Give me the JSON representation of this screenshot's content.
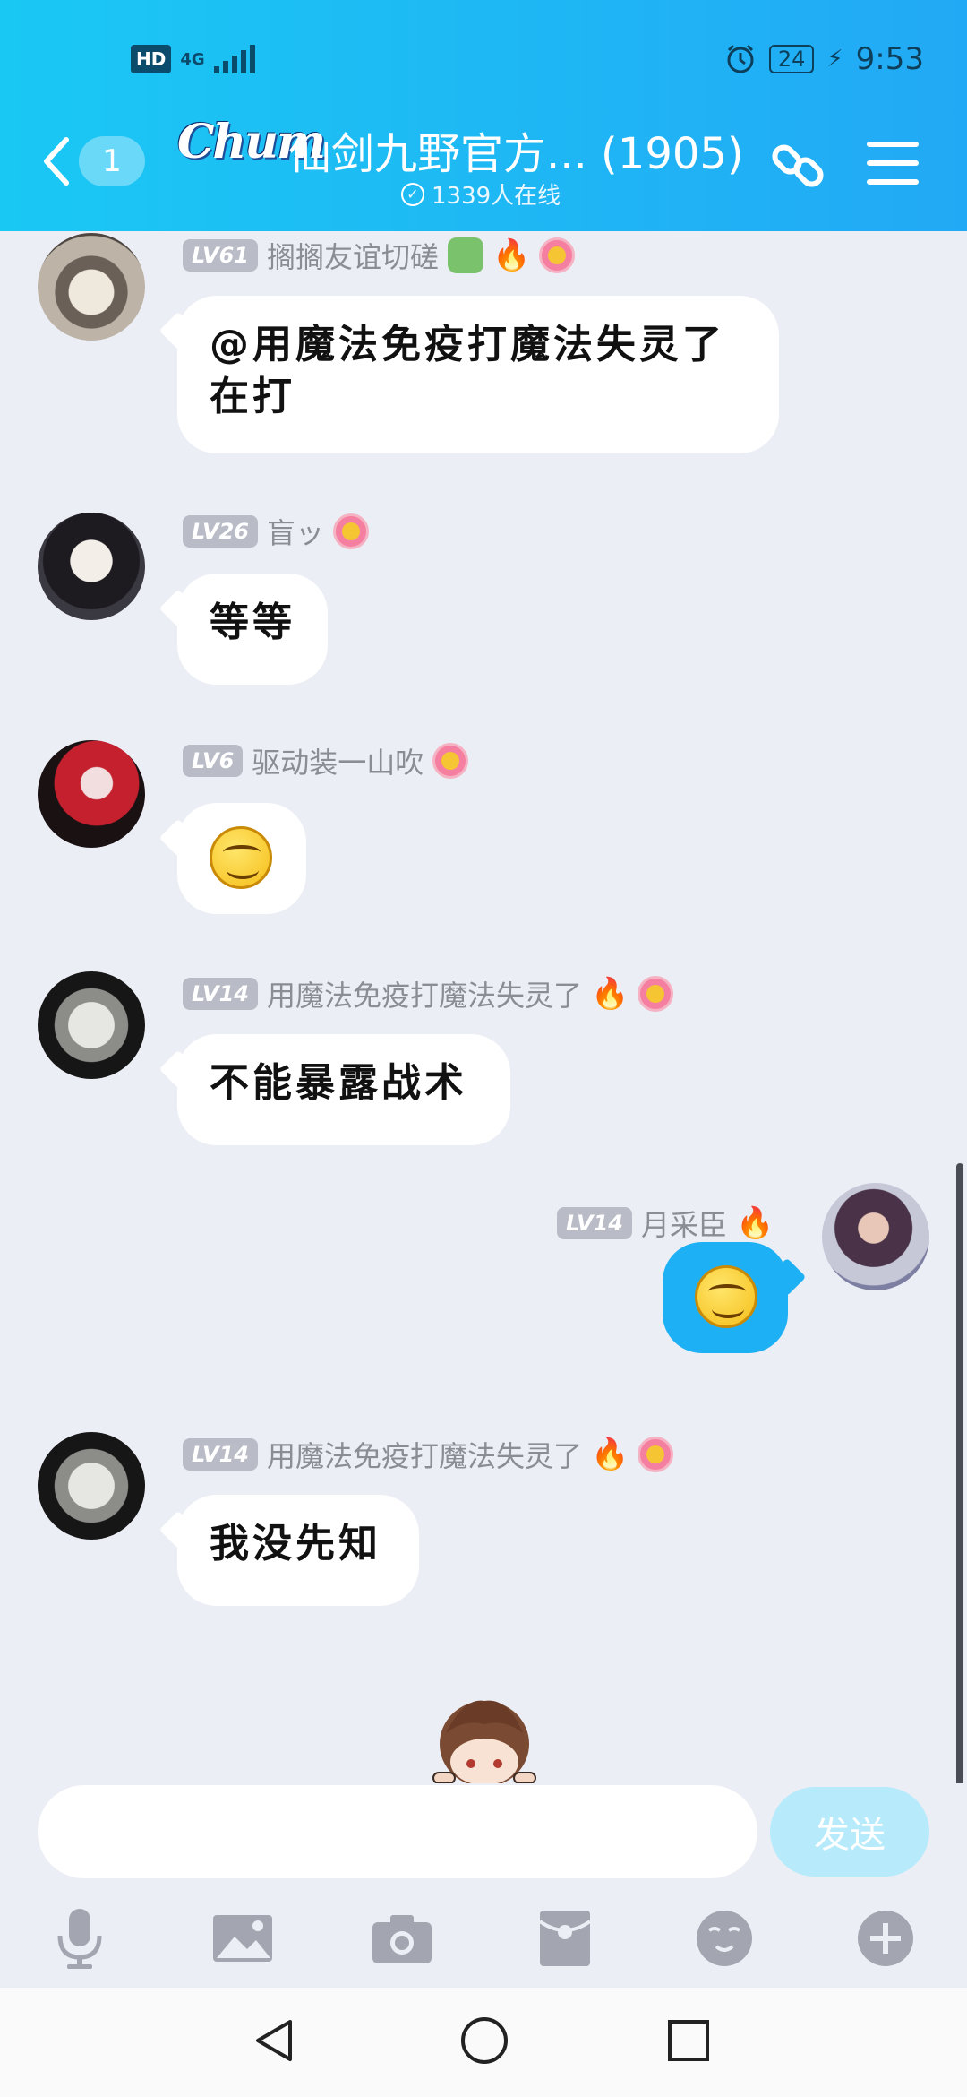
{
  "status_bar": {
    "hd": "HD",
    "network": "4G",
    "battery": "24",
    "time": "9:53"
  },
  "header": {
    "back_unread": "1",
    "logo_text": "Chum",
    "title": "仙剑九野官方...",
    "member_count": "(1905)",
    "online_text": "1339人在线"
  },
  "messages": [
    {
      "level": "LV61",
      "name": "搁搁友谊切磋",
      "text": "@用魔法免疫打魔法失灵了\n在打",
      "direction": "in"
    },
    {
      "level": "LV26",
      "name": "盲ッ",
      "text": "等等",
      "direction": "in"
    },
    {
      "level": "LV6",
      "name": "驱动装一山吹",
      "text": "",
      "sticker": "smirk-emoji",
      "direction": "in"
    },
    {
      "level": "LV14",
      "name": "用魔法免疫打魔法失灵了",
      "text": "不能暴露战术",
      "direction": "in"
    },
    {
      "level": "LV14",
      "name": "月采臣",
      "text": "",
      "sticker": "smirk-emoji",
      "direction": "out"
    },
    {
      "level": "LV14",
      "name": "用魔法免疫打魔法失灵了",
      "text": "我没先知",
      "direction": "in"
    }
  ],
  "input": {
    "placeholder": "",
    "send_label": "发送"
  },
  "toolbar_icons": [
    "microphone-icon",
    "image-icon",
    "camera-icon",
    "red-packet-icon",
    "emoji-icon",
    "plus-icon"
  ],
  "colors": {
    "header_start": "#1ac8f4",
    "header_end": "#22a9f5",
    "chat_bg": "#eceef5",
    "outgoing_bubble": "#1eb0f4",
    "send_button": "#b7ebfb"
  }
}
